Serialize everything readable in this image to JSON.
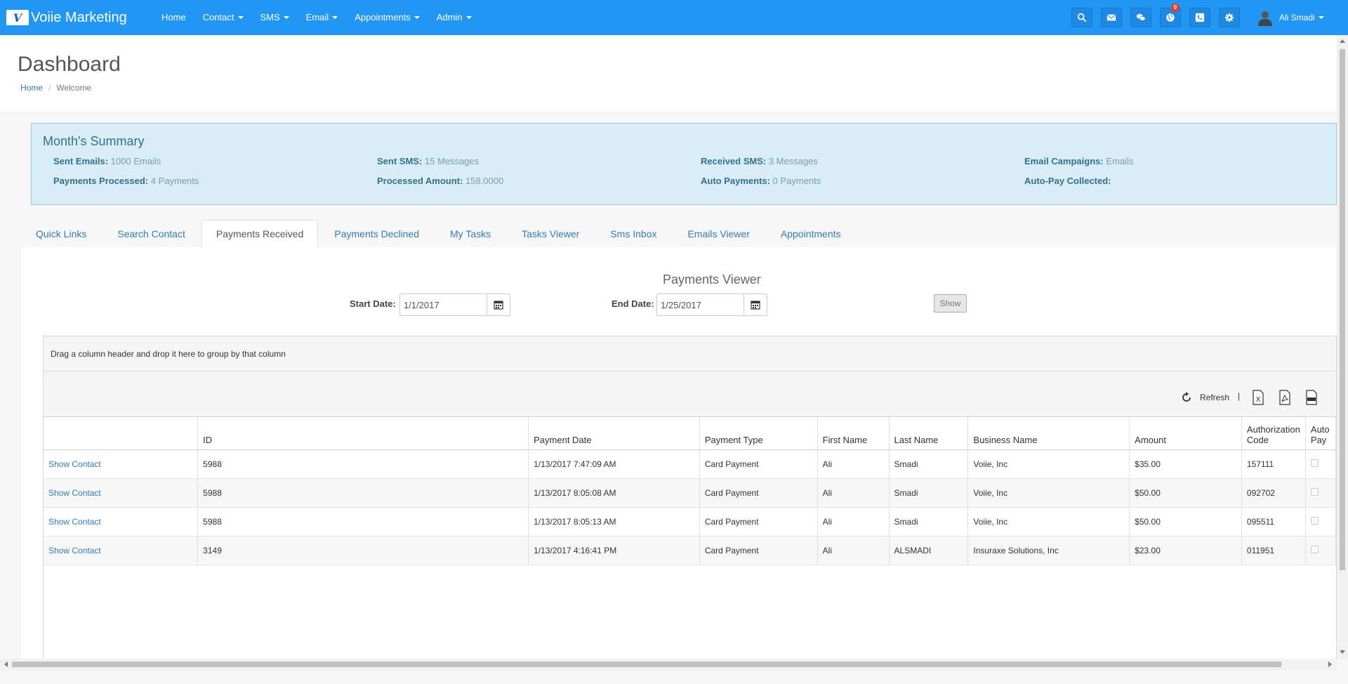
{
  "app": {
    "brand": "Voiie Marketing",
    "logo_letter": "V"
  },
  "nav": {
    "items": [
      {
        "label": "Home",
        "dropdown": false
      },
      {
        "label": "Contact",
        "dropdown": true
      },
      {
        "label": "SMS",
        "dropdown": true
      },
      {
        "label": "Email",
        "dropdown": true
      },
      {
        "label": "Appointments",
        "dropdown": true
      },
      {
        "label": "Admin",
        "dropdown": true
      }
    ],
    "icons": [
      "search-icon",
      "envelope-icon",
      "chat-icon",
      "globe-icon",
      "phone-icon",
      "gear-icon"
    ],
    "notification_count": "0",
    "user_name": "Ali Smadi"
  },
  "header": {
    "title": "Dashboard",
    "breadcrumb": {
      "home": "Home",
      "current": "Welcome"
    }
  },
  "summary": {
    "title": "Month's Summary",
    "items": [
      {
        "label": "Sent Emails:",
        "value": "1000 Emails"
      },
      {
        "label": "Sent SMS:",
        "value": "15 Messages"
      },
      {
        "label": "Received SMS:",
        "value": "3 Messages"
      },
      {
        "label": "Email Campaigns:",
        "value": "Emails"
      },
      {
        "label": "Payments Processed:",
        "value": "4 Payments"
      },
      {
        "label": "Processed Amount:",
        "value": "158.0000"
      },
      {
        "label": "Auto Payments:",
        "value": "0 Payments"
      },
      {
        "label": "Auto-Pay Collected:",
        "value": ""
      }
    ]
  },
  "tabs": {
    "items": [
      "Quick Links",
      "Search Contact",
      "Payments Received",
      "Payments Declined",
      "My Tasks",
      "Tasks Viewer",
      "Sms Inbox",
      "Emails Viewer",
      "Appointments"
    ],
    "active_index": 2
  },
  "viewer": {
    "title": "Payments Viewer",
    "start_label": "Start Date:",
    "start_value": "1/1/2017",
    "end_label": "End Date:",
    "end_value": "1/25/2017",
    "show_button": "Show"
  },
  "grid": {
    "group_hint": "Drag a column header and drop it here to group by that column",
    "refresh_label": "Refresh",
    "separator": "|",
    "export_icons": [
      "excel-export-icon",
      "pdf-export-icon",
      "csv-export-icon"
    ],
    "columns": [
      "",
      "ID",
      "Payment Date",
      "Payment Type",
      "First Name",
      "Last Name",
      "Business Name",
      "Amount",
      "Authorization Code",
      "Auto Pay"
    ],
    "rows": [
      {
        "link": "Show Contact",
        "id": "5988",
        "date": "1/13/2017 7:47:09 AM",
        "type": "Card Payment",
        "first": "Ali",
        "last": "Smadi",
        "business": "Voiie, Inc",
        "amount": "$35.00",
        "auth": "157111",
        "auto_pay": false
      },
      {
        "link": "Show Contact",
        "id": "5988",
        "date": "1/13/2017 8:05:08 AM",
        "type": "Card Payment",
        "first": "Ali",
        "last": "Smadi",
        "business": "Voiie, Inc",
        "amount": "$50.00",
        "auth": "092702",
        "auto_pay": false
      },
      {
        "link": "Show Contact",
        "id": "5988",
        "date": "1/13/2017 8:05:13 AM",
        "type": "Card Payment",
        "first": "Ali",
        "last": "Smadi",
        "business": "Voiie, Inc",
        "amount": "$50.00",
        "auth": "095511",
        "auto_pay": false
      },
      {
        "link": "Show Contact",
        "id": "3149",
        "date": "1/13/2017 4:16:41 PM",
        "type": "Card Payment",
        "first": "Ali",
        "last": "ALSMADI",
        "business": "Insuraxe Solutions, Inc",
        "amount": "$23.00",
        "auth": "011951",
        "auto_pay": false
      }
    ]
  },
  "colors": {
    "navbar": "#2196f3",
    "summary_bg": "#d9edf7",
    "summary_text": "#31708f",
    "link": "#337ab7",
    "badge": "#e53935"
  }
}
